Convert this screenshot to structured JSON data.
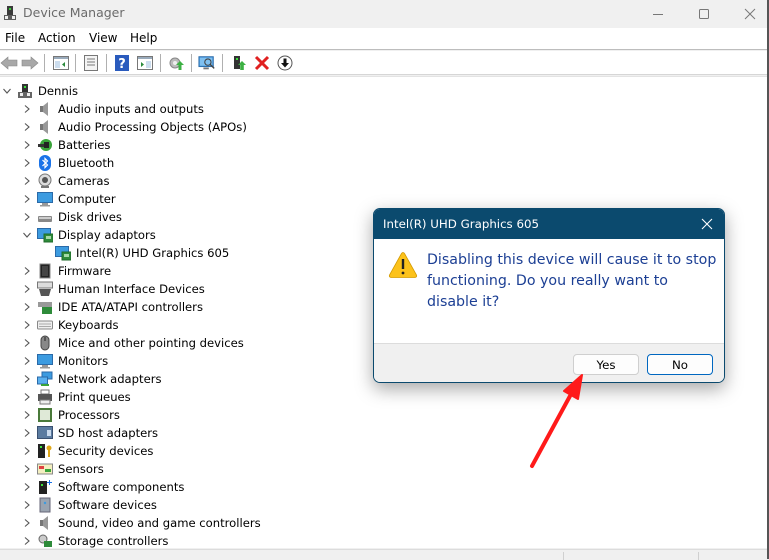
{
  "window": {
    "title": "Device Manager",
    "controls": {
      "minimize": "minimize",
      "maximize": "maximize",
      "close": "close"
    }
  },
  "menubar": {
    "items": [
      "File",
      "Action",
      "View",
      "Help"
    ]
  },
  "toolbar": {
    "buttons": [
      {
        "name": "back",
        "icon": "back-arrow-icon"
      },
      {
        "name": "forward",
        "icon": "forward-arrow-icon"
      },
      {
        "name": "show-hide-console-tree",
        "icon": "console-tree-icon"
      },
      {
        "name": "properties",
        "icon": "properties-icon"
      },
      {
        "name": "help",
        "icon": "help-icon"
      },
      {
        "name": "show-action-pane",
        "icon": "action-pane-icon"
      },
      {
        "name": "update-driver",
        "icon": "update-driver-icon"
      },
      {
        "name": "scan-hardware-changes",
        "icon": "scan-monitor-icon"
      },
      {
        "name": "enable-device",
        "icon": "enable-device-icon"
      },
      {
        "name": "uninstall-device",
        "icon": "uninstall-x-icon"
      },
      {
        "name": "disable-device",
        "icon": "disable-down-arrow-icon"
      }
    ]
  },
  "tree": {
    "root": {
      "label": "Dennis",
      "expanded": true,
      "icon": "computer-root-icon"
    },
    "categories": [
      {
        "label": "Audio inputs and outputs",
        "icon": "speaker-icon",
        "expanded": false
      },
      {
        "label": "Audio Processing Objects (APOs)",
        "icon": "speaker-icon",
        "expanded": false
      },
      {
        "label": "Batteries",
        "icon": "battery-icon",
        "expanded": false
      },
      {
        "label": "Bluetooth",
        "icon": "bluetooth-icon",
        "expanded": false
      },
      {
        "label": "Cameras",
        "icon": "camera-icon",
        "expanded": false
      },
      {
        "label": "Computer",
        "icon": "monitor-icon",
        "expanded": false
      },
      {
        "label": "Disk drives",
        "icon": "disk-drive-icon",
        "expanded": false
      },
      {
        "label": "Display adaptors",
        "icon": "display-adapter-icon",
        "expanded": true,
        "children": [
          {
            "label": "Intel(R) UHD Graphics 605",
            "icon": "display-adapter-icon"
          }
        ]
      },
      {
        "label": "Firmware",
        "icon": "chip-icon",
        "expanded": false
      },
      {
        "label": "Human Interface Devices",
        "icon": "hid-icon",
        "expanded": false
      },
      {
        "label": "IDE ATA/ATAPI controllers",
        "icon": "ide-controller-icon",
        "expanded": false
      },
      {
        "label": "Keyboards",
        "icon": "keyboard-icon",
        "expanded": false
      },
      {
        "label": "Mice and other pointing devices",
        "icon": "mouse-icon",
        "expanded": false
      },
      {
        "label": "Monitors",
        "icon": "monitor-icon",
        "expanded": false
      },
      {
        "label": "Network adapters",
        "icon": "network-icon",
        "expanded": false
      },
      {
        "label": "Print queues",
        "icon": "printer-icon",
        "expanded": false
      },
      {
        "label": "Processors",
        "icon": "processor-icon",
        "expanded": false
      },
      {
        "label": "SD host adapters",
        "icon": "sd-card-icon",
        "expanded": false
      },
      {
        "label": "Security devices",
        "icon": "security-key-icon",
        "expanded": false
      },
      {
        "label": "Sensors",
        "icon": "sensor-icon",
        "expanded": false
      },
      {
        "label": "Software components",
        "icon": "software-component-icon",
        "expanded": false
      },
      {
        "label": "Software devices",
        "icon": "software-device-icon",
        "expanded": false
      },
      {
        "label": "Sound, video and game controllers",
        "icon": "speaker-icon",
        "expanded": false
      },
      {
        "label": "Storage controllers",
        "icon": "storage-controller-icon",
        "expanded": false
      }
    ]
  },
  "dialog": {
    "title": "Intel(R) UHD Graphics 605",
    "icon": "warning-icon",
    "message": "Disabling this device will cause it to stop functioning. Do you really want to disable it?",
    "buttons": {
      "yes": "Yes",
      "no": "No"
    }
  },
  "annotation": {
    "type": "arrow",
    "color": "#ff1a1a",
    "points_to": "Yes"
  },
  "colors": {
    "dialog_title_bg": "#0b4a6e",
    "dialog_message": "#1c3f94",
    "default_button_border": "#0067c0",
    "annotation_arrow": "#ff1a1a"
  }
}
